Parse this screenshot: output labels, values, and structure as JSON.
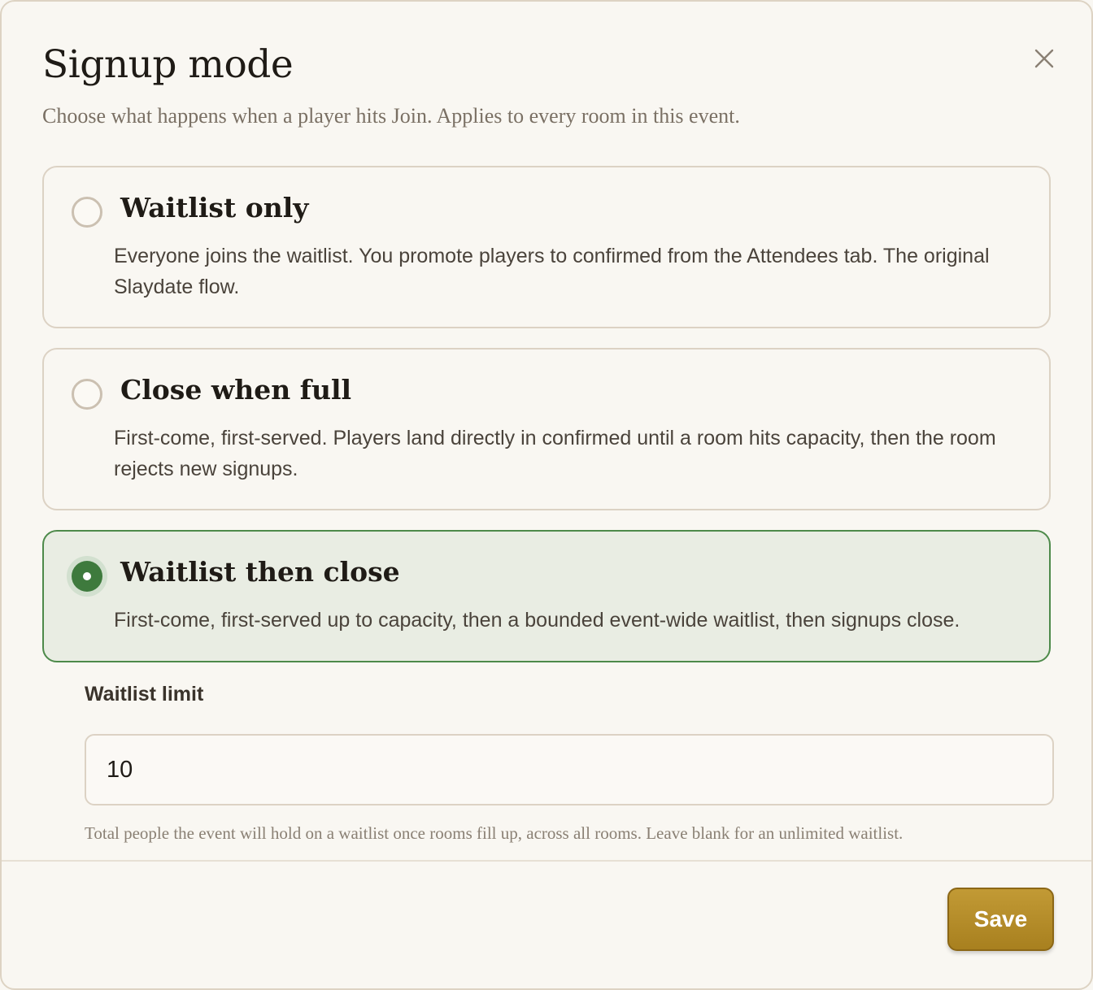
{
  "dialog": {
    "title": "Signup mode",
    "subtitle": "Choose what happens when a player hits Join. Applies to every room in this event.",
    "close_icon": "close-icon"
  },
  "options": [
    {
      "title": "Waitlist only",
      "description": "Everyone joins the waitlist. You promote players to confirmed from the Attendees tab. The original Slaydate flow.",
      "selected": false
    },
    {
      "title": "Close when full",
      "description": "First-come, first-served. Players land directly in confirmed until a room hits capacity, then the room rejects new signups.",
      "selected": false
    },
    {
      "title": "Waitlist then close",
      "description": "First-come, first-served up to capacity, then a bounded event-wide waitlist, then signups close.",
      "selected": true
    }
  ],
  "waitlist_limit": {
    "label": "Waitlist limit",
    "value": "10",
    "helper": "Total people the event will hold on a waitlist once rooms fill up, across all rooms. Leave blank for an unlimited waitlist."
  },
  "footer": {
    "save_label": "Save"
  },
  "colors": {
    "accent_green": "#3e7a3d",
    "selected_bg": "#e9ede3",
    "save_gold": "#b38a27"
  }
}
